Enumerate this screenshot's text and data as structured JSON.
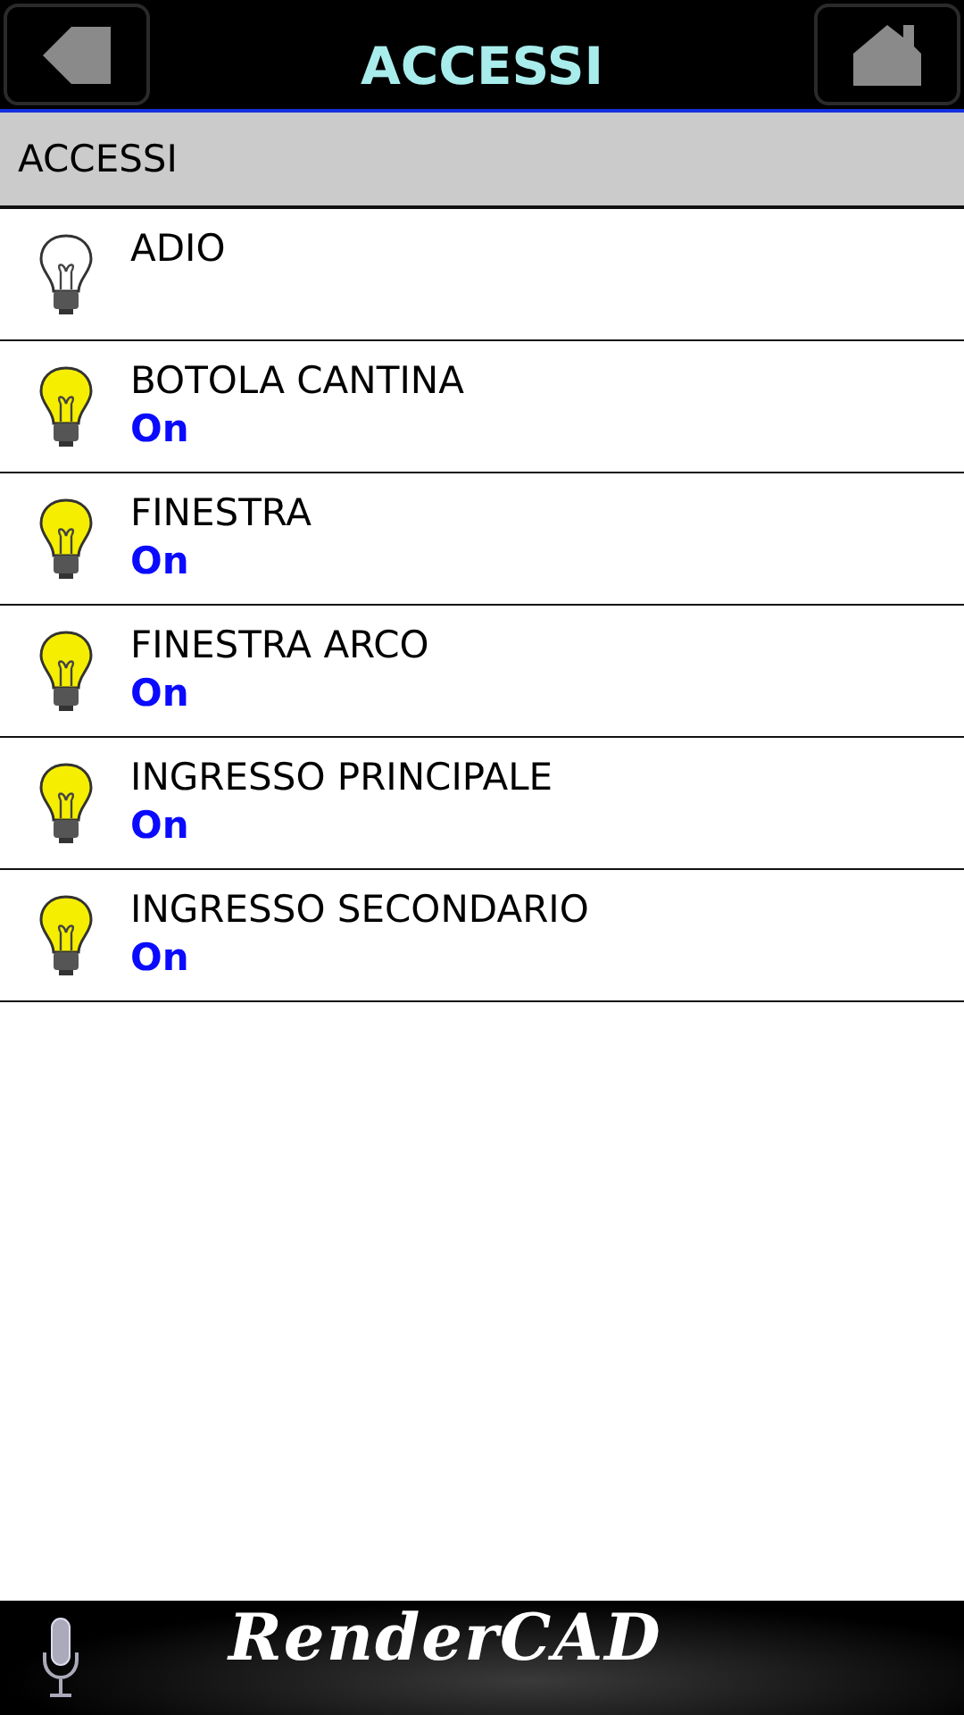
{
  "header": {
    "title": "ACCESSI"
  },
  "section": {
    "title": "ACCESSI"
  },
  "items": [
    {
      "name": "ADIO",
      "on": false
    },
    {
      "name": "BOTOLA CANTINA",
      "on": true,
      "status": "On"
    },
    {
      "name": "FINESTRA",
      "on": true,
      "status": "On"
    },
    {
      "name": "FINESTRA ARCO",
      "on": true,
      "status": "On"
    },
    {
      "name": "INGRESSO PRINCIPALE",
      "on": true,
      "status": "On"
    },
    {
      "name": "INGRESSO SECONDARIO",
      "on": true,
      "status": "On"
    }
  ],
  "footer": {
    "logo": "RenderCAD"
  }
}
